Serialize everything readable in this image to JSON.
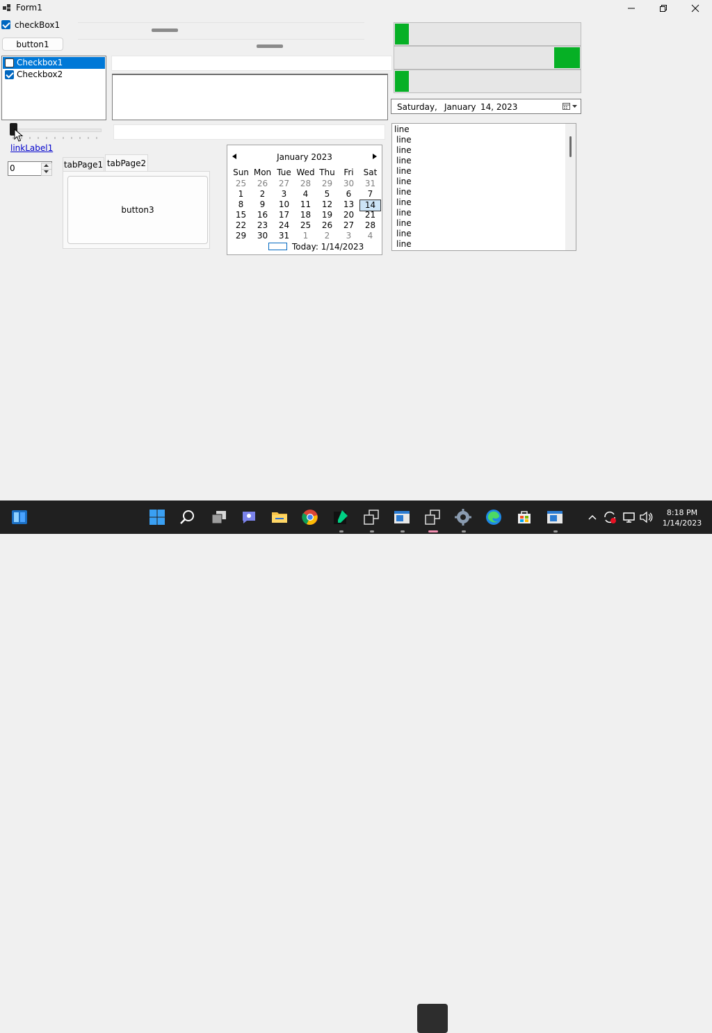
{
  "window": {
    "title": "Form1"
  },
  "controls": {
    "checkbox1": {
      "label": "checkBox1",
      "checked": true
    },
    "button1": "button1",
    "checked_list": [
      {
        "label": "Checkbox1",
        "checked": false,
        "selected": true
      },
      {
        "label": "Checkbox2",
        "checked": true,
        "selected": false
      }
    ],
    "link_label": "linkLabel1",
    "numeric_value": "0",
    "tabs": [
      "tabPage1",
      "tabPage2"
    ],
    "button3": "button3",
    "progress_bars": [
      {
        "value_percent": 8
      },
      {
        "value_percent": 14
      },
      {
        "value_percent": 8
      }
    ],
    "date_picker": {
      "day": "Saturday",
      "month": "January",
      "date": "14, 2023"
    },
    "list_items": [
      "line",
      "line",
      "line",
      "line",
      "line",
      "line",
      "line",
      "line",
      "line",
      "line",
      "line",
      "line"
    ]
  },
  "calendar": {
    "title": "January 2023",
    "day_headers": [
      "Sun",
      "Mon",
      "Tue",
      "Wed",
      "Thu",
      "Fri",
      "Sat"
    ],
    "weeks": [
      [
        "25",
        "26",
        "27",
        "28",
        "29",
        "30",
        "31"
      ],
      [
        "1",
        "2",
        "3",
        "4",
        "5",
        "6",
        "7"
      ],
      [
        "8",
        "9",
        "10",
        "11",
        "12",
        "13",
        "14"
      ],
      [
        "15",
        "16",
        "17",
        "18",
        "19",
        "20",
        "21"
      ],
      [
        "22",
        "23",
        "24",
        "25",
        "26",
        "27",
        "28"
      ],
      [
        "29",
        "30",
        "31",
        "1",
        "2",
        "3",
        "4"
      ]
    ],
    "selected": "14",
    "today_label": "Today: 1/14/2023"
  },
  "taskbar": {
    "time": "8:18 PM",
    "date": "1/14/2023",
    "icons": [
      "widgets-icon",
      "start-icon",
      "search-icon",
      "task-view-icon",
      "teams-chat-icon",
      "file-explorer-icon",
      "chrome-icon",
      "notepad-icon",
      "app-window-icon",
      "form-app-icon",
      "active-app-icon",
      "settings-icon",
      "edge-icon",
      "store-icon",
      "app-icon"
    ]
  },
  "colors": {
    "accent": "#0067c0",
    "progress": "#06b025",
    "taskbar": "#202020"
  }
}
